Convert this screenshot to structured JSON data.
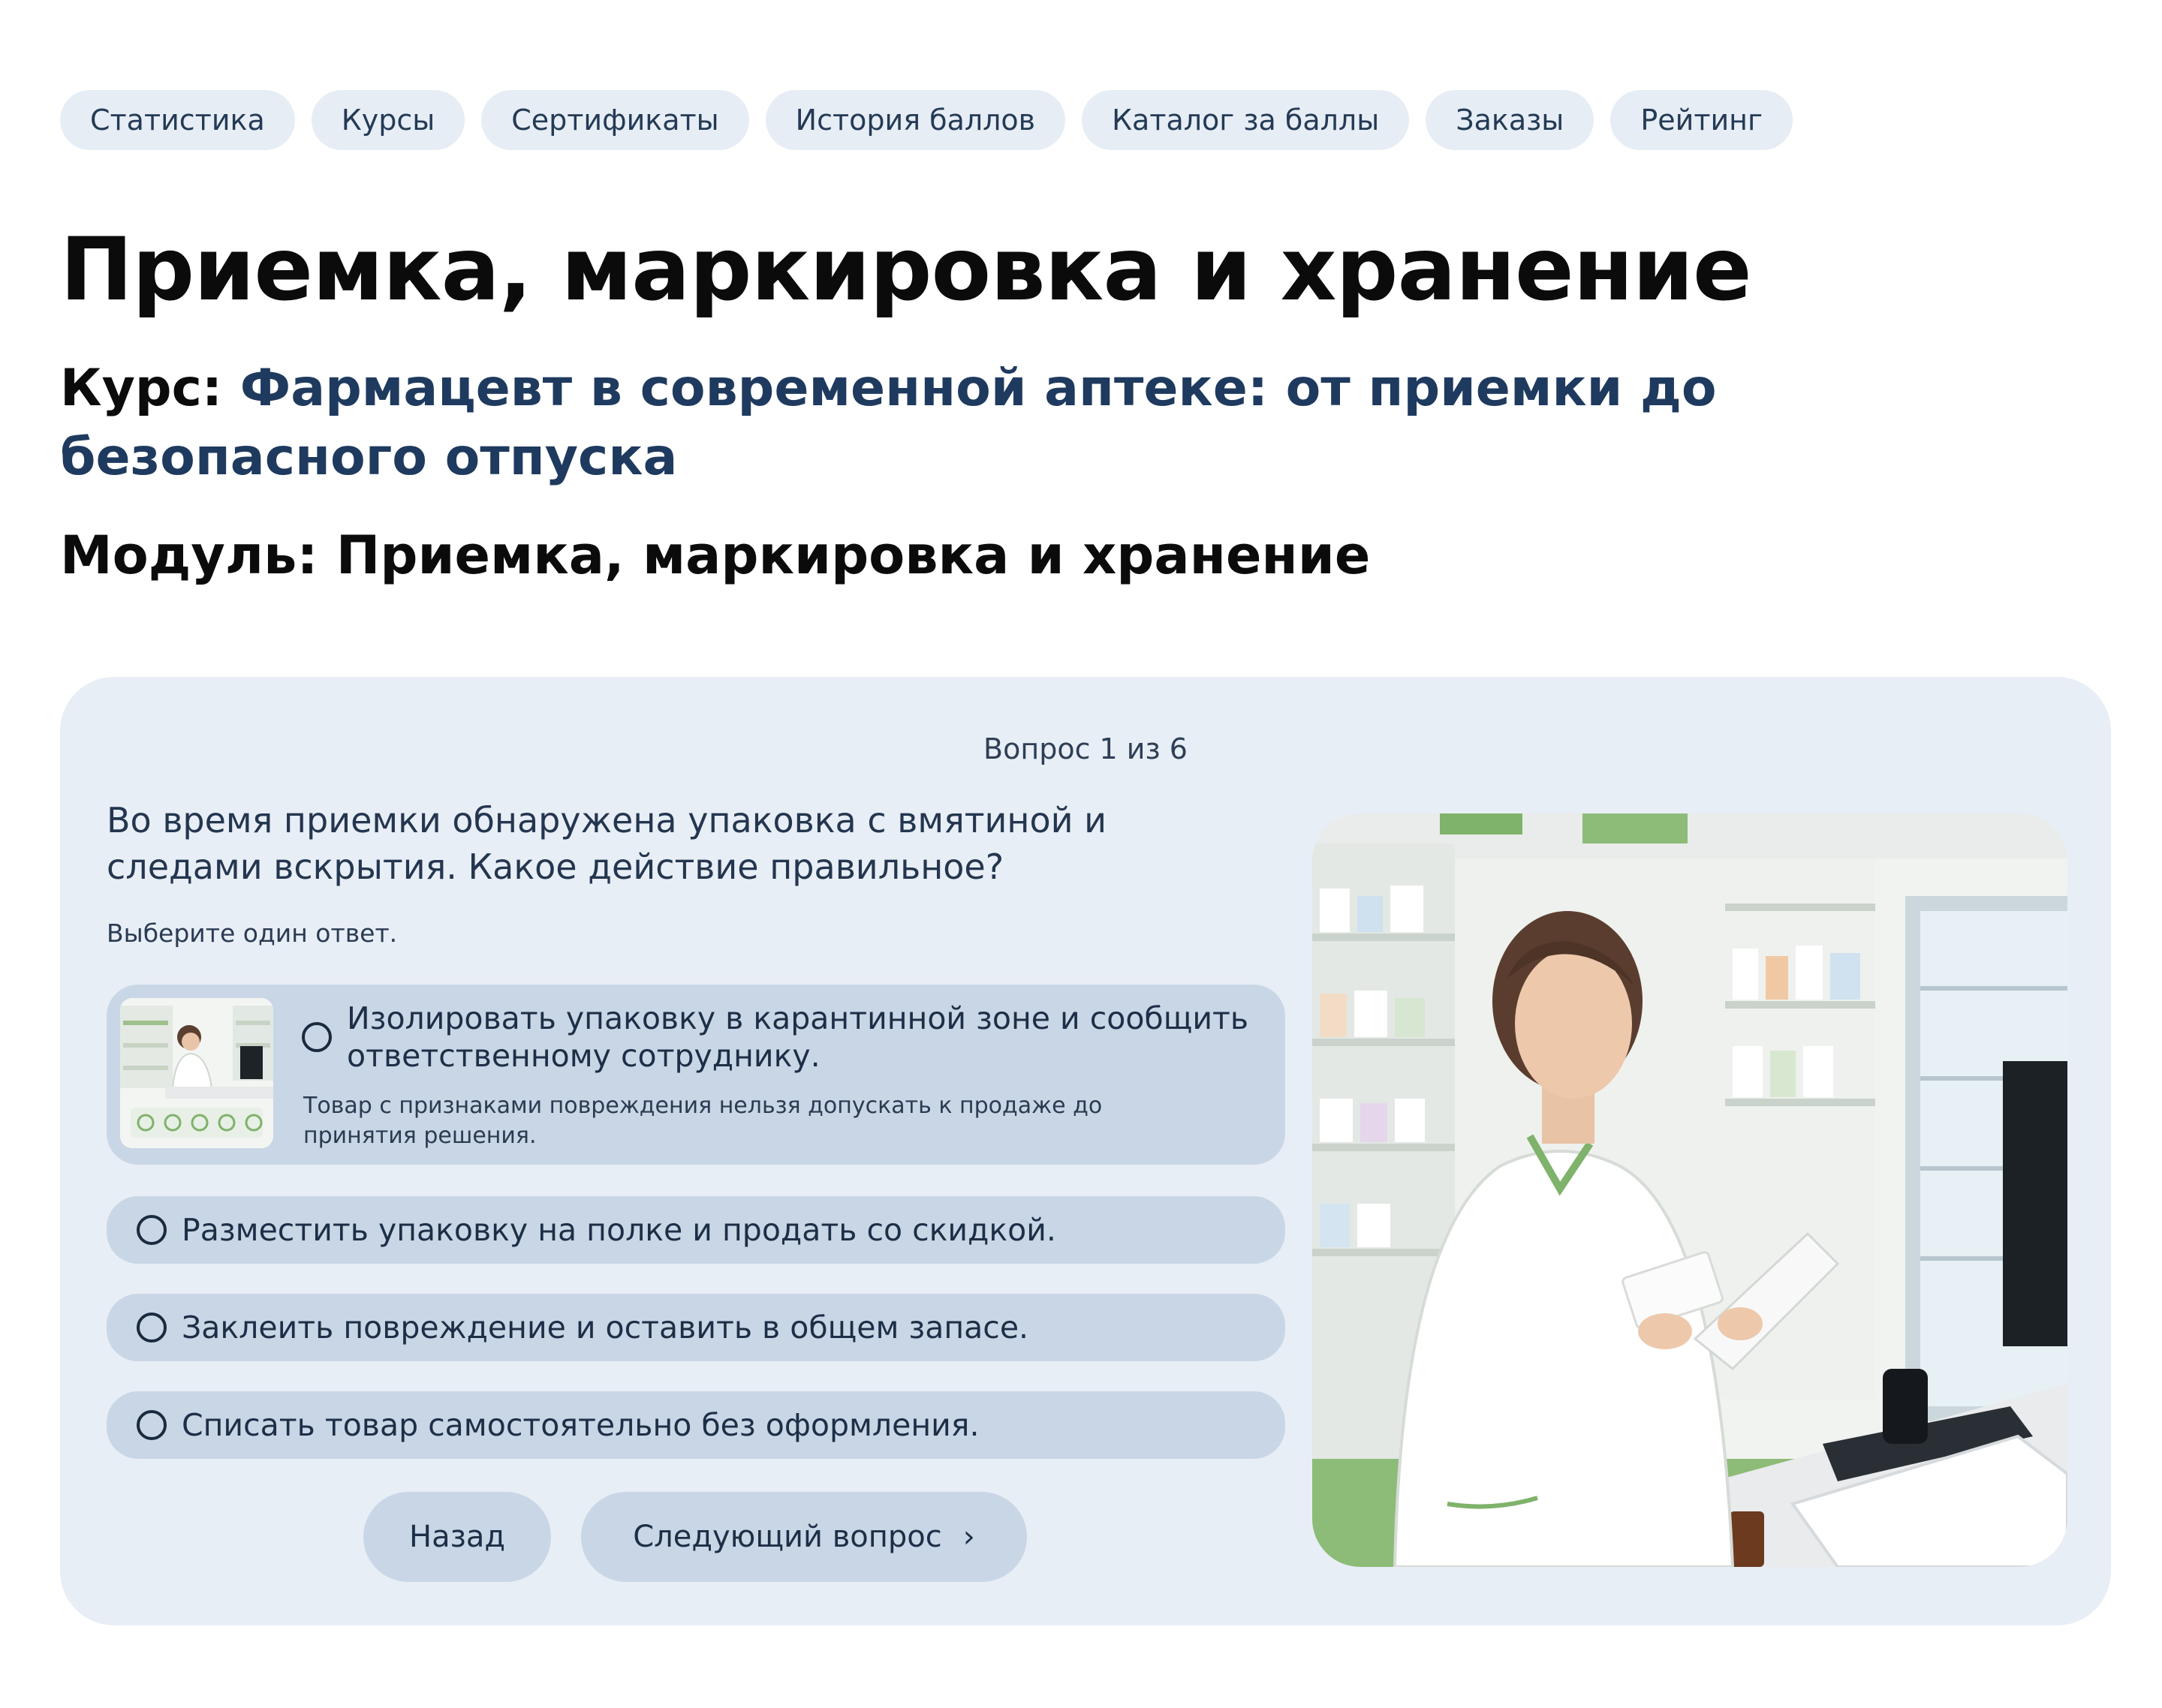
{
  "nav": {
    "items": [
      "Статистика",
      "Курсы",
      "Сертификаты",
      "История баллов",
      "Каталог за баллы",
      "Заказы",
      "Рейтинг"
    ]
  },
  "page": {
    "title": "Приемка, маркировка и хранение",
    "course_label": "Курс:",
    "course_name": "Фармацевт в современной аптеке: от приемки до безопасного отпуска",
    "module_text": "Модуль: Приемка, маркировка и хранение"
  },
  "quiz": {
    "progress": "Вопрос 1 из 6",
    "question": "Во время приемки обнаружена упаковка с вмятиной и следами вскрытия. Какое действие правильное?",
    "hint": "Выберите один ответ.",
    "answers": [
      {
        "text": "Изолировать упаковку в карантинной зоне и сообщить ответственному сотруднику.",
        "explanation": "Товар с признаками повреждения нельзя допускать к продаже до принятия решения."
      },
      {
        "text": "Разместить упаковку на полке и продать со скидкой."
      },
      {
        "text": "Заклеить повреждение и оставить в общем запасе."
      },
      {
        "text": "Списать товар самостоятельно без оформления."
      }
    ],
    "back_label": "Назад",
    "next_label": "Следующий вопрос",
    "next_icon": "chevron-right-icon"
  },
  "colors": {
    "pill_bg": "#e6edf5",
    "card_bg": "#e8eef6",
    "answer_bg": "#c9d6e5",
    "link": "#1f3a5f",
    "pharmacy_green": "#7fb26a"
  }
}
